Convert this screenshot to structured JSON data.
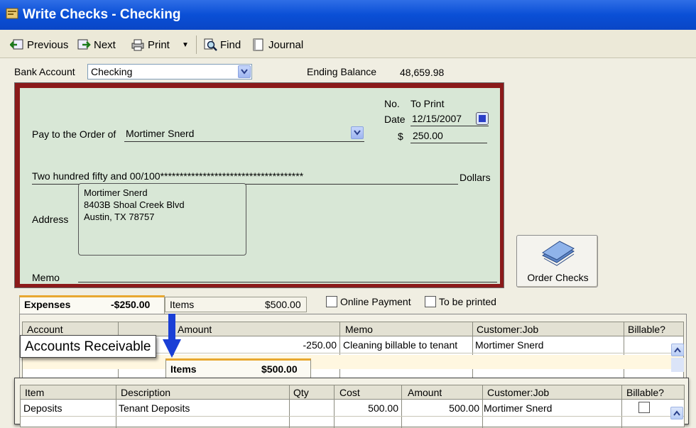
{
  "window": {
    "title": "Write Checks - Checking"
  },
  "toolbar": {
    "previous": "Previous",
    "next": "Next",
    "print": "Print",
    "find": "Find",
    "journal": "Journal"
  },
  "bank": {
    "label": "Bank Account",
    "account": "Checking",
    "ending_label": "Ending Balance",
    "ending_value": "48,659.98"
  },
  "check": {
    "no_label": "No.",
    "no_value": "To Print",
    "date_label": "Date",
    "date_value": "12/15/2007",
    "dollar_sign": "$",
    "amount": "250.00",
    "payee_label": "Pay to the Order of",
    "payee": "Mortimer Snerd",
    "written_amount": "Two hundred fifty and 00/100*************************************",
    "dollars_label": "Dollars",
    "address_label": "Address",
    "address_lines": [
      "Mortimer Snerd",
      "8403B Shoal Creek Blvd",
      "Austin, TX 78757"
    ],
    "memo_label": "Memo"
  },
  "order_checks": {
    "label": "Order Checks"
  },
  "tabs": {
    "expenses_label": "Expenses",
    "expenses_amount": "-$250.00",
    "items_label": "Items",
    "items_amount": "$500.00",
    "online_payment": "Online Payment",
    "to_be_printed": "To be printed"
  },
  "expenses_grid": {
    "headers": [
      "Account",
      "Amount",
      "Memo",
      "Customer:Job",
      "Billable?"
    ],
    "row": {
      "account": "Accounts Receivable",
      "amount": "-250.00",
      "memo": "Cleaning billable to tenant",
      "customer": "Mortimer Snerd"
    }
  },
  "items_overlay": {
    "tab_label": "Items",
    "tab_amount": "$500.00",
    "headers": [
      "Item",
      "Description",
      "Qty",
      "Cost",
      "Amount",
      "Customer:Job",
      "Billable?"
    ],
    "row": {
      "item": "Deposits",
      "description": "Tenant Deposits",
      "qty": "",
      "cost": "500.00",
      "amount": "500.00",
      "customer": "Mortimer Snerd"
    }
  },
  "colors": {
    "titlebar": "#0a4fd6",
    "check_bg": "#d8e7d6",
    "check_border": "#8b1a1a",
    "arrow": "#1a3fd6"
  }
}
